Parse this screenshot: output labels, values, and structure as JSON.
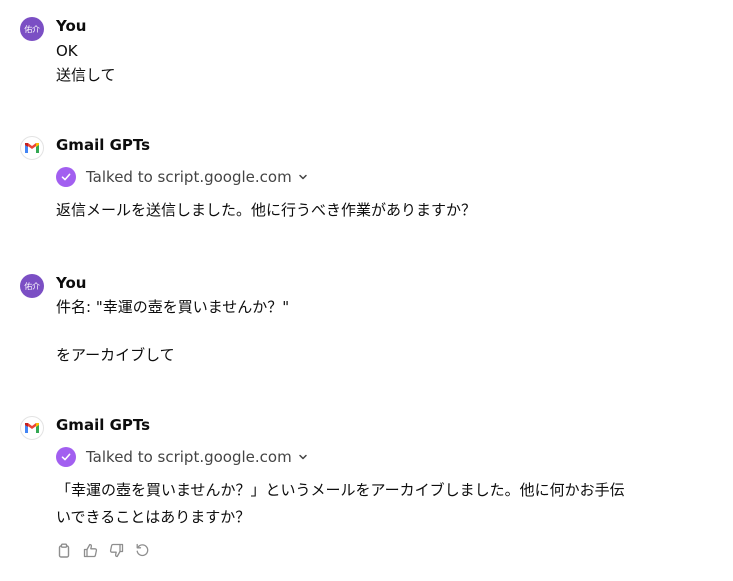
{
  "user": {
    "avatar_text": "佑介",
    "name": "You",
    "avatar_color": "#7b4fc4"
  },
  "assistant": {
    "name": "Gmail GPTs",
    "avatar_icon": "gmail-logo"
  },
  "tool_call": {
    "label": "Talked to script.google.com",
    "icon": "check-icon",
    "accent": "#a25ff0"
  },
  "messages": [
    {
      "lines": [
        "OK",
        "送信して"
      ]
    },
    {
      "lines": [
        "返信メールを送信しました。他に行うべき作業がありますか？"
      ]
    },
    {
      "lines": [
        "件名: \"幸運の壺を買いませんか？\"",
        "",
        "をアーカイブして"
      ]
    },
    {
      "lines": [
        "「幸運の壺を買いませんか？」というメールをアーカイブしました。他に何かお手伝",
        "いできることはありますか？"
      ]
    }
  ],
  "action_icons": [
    "copy-icon",
    "thumbs-up-icon",
    "thumbs-down-icon",
    "regenerate-icon"
  ]
}
